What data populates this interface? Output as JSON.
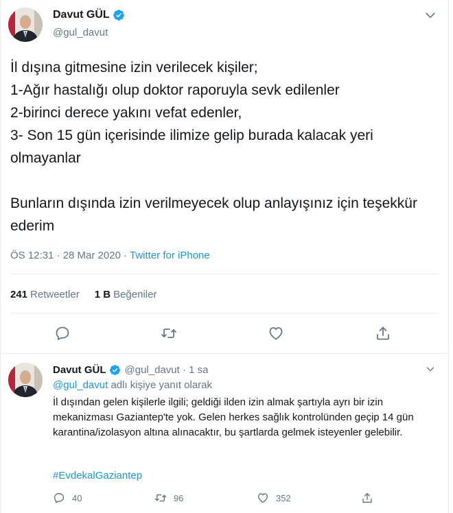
{
  "main_tweet": {
    "display_name": "Davut GÜL",
    "handle": "@gul_davut",
    "text": "İl dışına gitmesine izin verilecek kişiler;\n1-Ağır hastalığı olup doktor raporuyla sevk edilenler\n2-birinci derece yakını vefat edenler,\n3- Son 15 gün içerisinde ilimize gelip burada kalacak yeri olmayanlar\n\nBunların dışında izin verilmeyecek olup anlayışınız için teşekkür ederim",
    "timestamp": "ÖS 12:31 · 28 Mar 2020 · ",
    "source": "Twitter for iPhone",
    "retweet_count": "241",
    "retweet_label": "Retweetler",
    "like_count": "1 B",
    "like_label": "Beğeniler"
  },
  "reply_tweet": {
    "display_name": "Davut GÜL",
    "handle_time": "@gul_davut · 1 sa",
    "replying_mention": "@gul_davut",
    "replying_suffix": " adlı kişiye yanıt olarak",
    "text": "İl dışından gelen kişilerle ilgili; geldiği ilden izin almak şartıyla ayrı bir izin mekanizması Gaziantep'te yok. Gelen herkes sağlık kontrolünden geçip 14 gün karantina/izolasyon altına alınacaktır, bu şartlarda gelmek isteyenler gelebilir.",
    "hashtag": "#EvdekalGaziantep",
    "reply_count": "40",
    "retweet_count": "96",
    "like_count": "352"
  },
  "icons": {
    "verified": "verified-badge-icon",
    "chevron": "chevron-down-icon",
    "reply": "reply-icon",
    "retweet": "retweet-icon",
    "like": "heart-icon",
    "share": "share-icon"
  },
  "colors": {
    "accent": "#1b95e0",
    "verified": "#1da1f2",
    "secondary_text": "#657786",
    "divider": "#e6ecf0"
  }
}
